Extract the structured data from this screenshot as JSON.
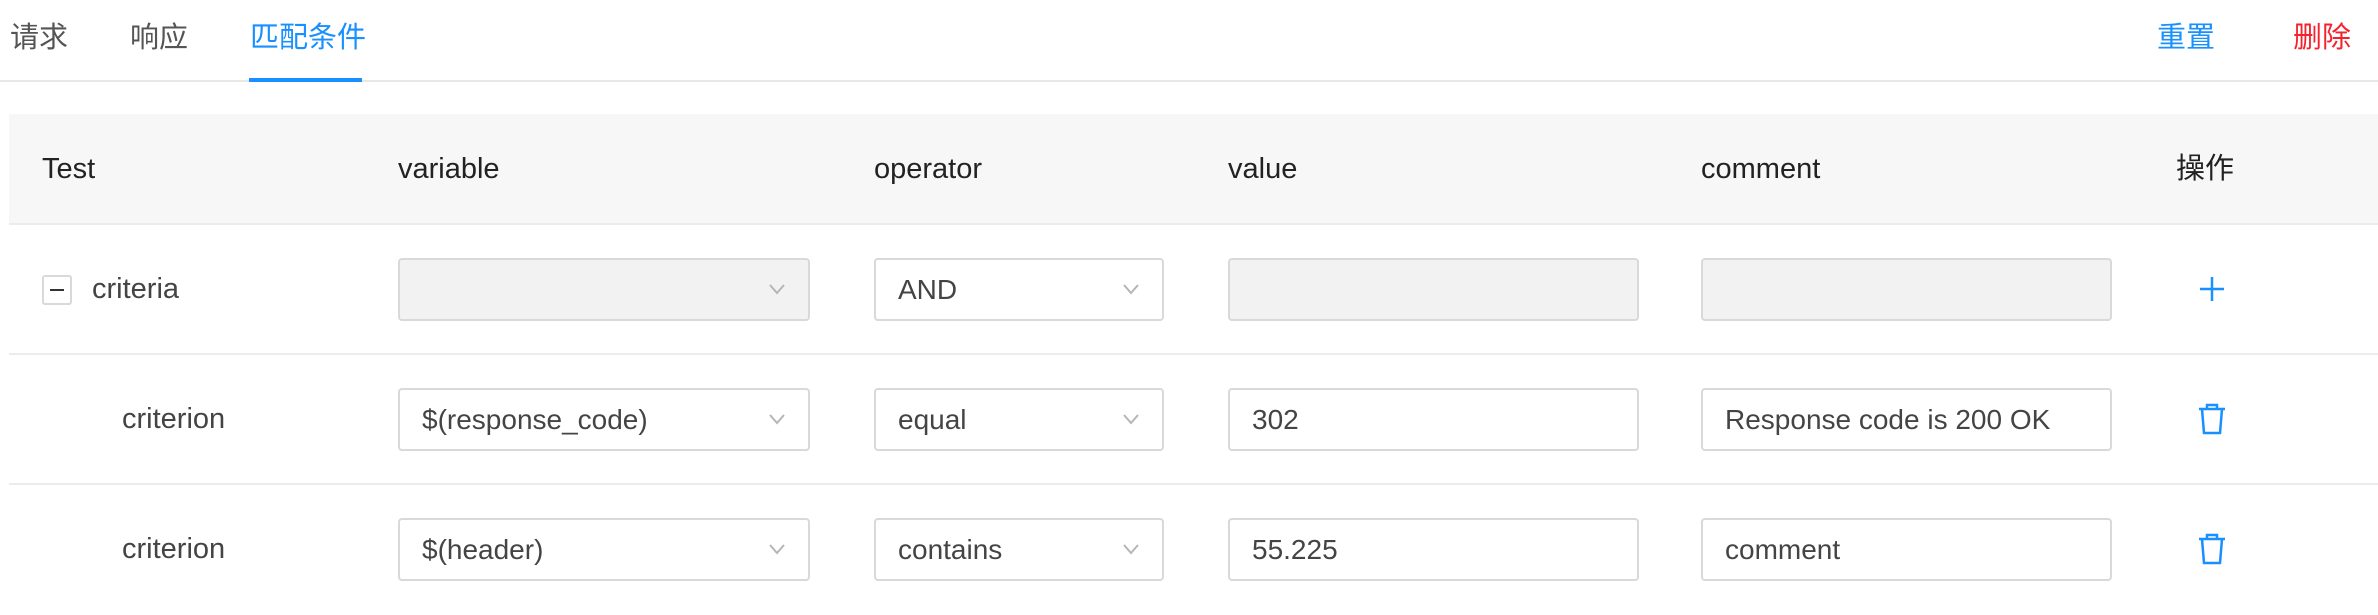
{
  "tabs": [
    {
      "label": "请求",
      "active": false
    },
    {
      "label": "响应",
      "active": false
    },
    {
      "label": "匹配条件",
      "active": true
    }
  ],
  "actions": {
    "reset": "重置",
    "delete": "删除"
  },
  "table": {
    "headers": {
      "test": "Test",
      "variable": "variable",
      "operator": "operator",
      "value": "value",
      "comment": "comment",
      "actions": "操作"
    },
    "rows": [
      {
        "test": "criteria",
        "variable": "",
        "operator": "AND",
        "value": "",
        "comment": "",
        "action_icon": "plus-icon"
      },
      {
        "test": "criterion",
        "variable": "$(response_code)",
        "operator": "equal",
        "value": "302",
        "comment": "Response code is 200 OK",
        "action_icon": "trash-icon"
      },
      {
        "test": "criterion",
        "variable": "$(header)",
        "operator": "contains",
        "value": "55.225",
        "comment": "comment",
        "action_icon": "trash-icon"
      }
    ]
  },
  "colors": {
    "primary": "#1890ff",
    "danger": "#f5222d",
    "header_bg": "#f7f7f7",
    "disabled_bg": "#f2f2f2"
  }
}
